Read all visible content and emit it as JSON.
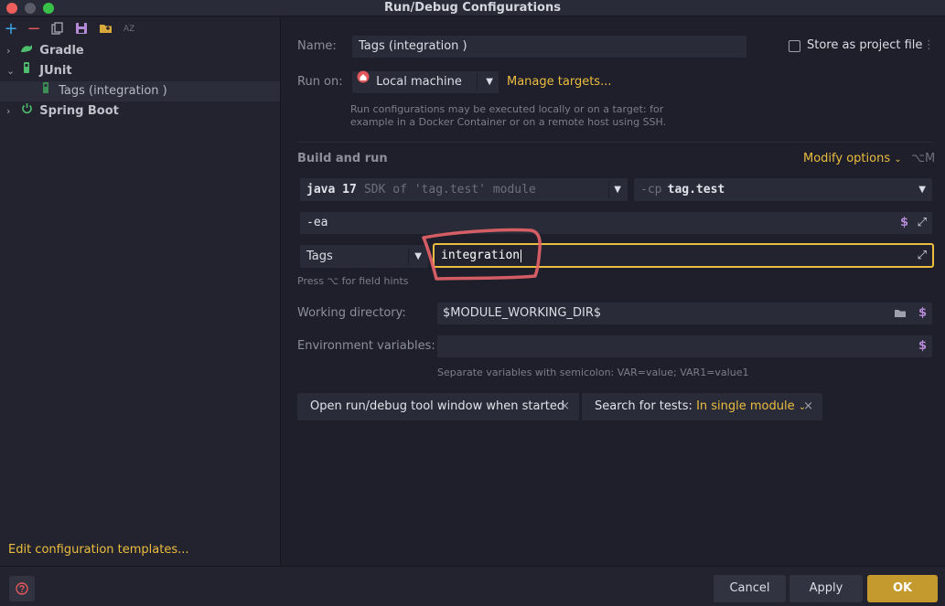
{
  "window": {
    "title": "Run/Debug Configurations"
  },
  "toolbar": {
    "add_icon": "+",
    "remove_icon": "−",
    "copy_icon": "copy-icon",
    "save_icon": "save-icon",
    "folder_icon": "new-folder-icon",
    "sort_label": "AZ"
  },
  "tree": {
    "items": [
      {
        "label": "Gradle"
      },
      {
        "label": "JUnit"
      },
      {
        "label": "Tags (integration )"
      },
      {
        "label": "Spring Boot"
      }
    ]
  },
  "sidebar": {
    "edit_templates": "Edit configuration templates..."
  },
  "form": {
    "name_label": "Name:",
    "name_value": "Tags (integration )",
    "store_label": "Store as project file",
    "run_on_label": "Run on:",
    "run_on_value": "Local machine",
    "manage_targets": "Manage targets...",
    "run_on_hint_1": "Run configurations may be executed locally or on a target: for",
    "run_on_hint_2": "example in a Docker Container or on a remote host using SSH.",
    "build_run_label": "Build and run",
    "modify_options": "Modify options",
    "modify_shortcut": "⌥M",
    "jdk_main": "java 17",
    "jdk_sub": "SDK of 'tag.test' module",
    "cp_prefix": "-cp",
    "cp_value": "tag.test",
    "vm_options": "-ea",
    "test_kind": "Tags",
    "tags_value": "integration",
    "field_hint": "Press ⌥ for field hints",
    "workdir_label": "Working directory:",
    "workdir_value": "$MODULE_WORKING_DIR$",
    "env_label": "Environment variables:",
    "env_value": "",
    "env_hint": "Separate variables with semicolon: VAR=value; VAR1=value1",
    "chip1": "Open run/debug tool window when started",
    "chip2_label": "Search for tests:",
    "chip2_value": "In single module"
  },
  "buttons": {
    "cancel": "Cancel",
    "apply": "Apply",
    "ok": "OK"
  },
  "colors": {
    "accent": "#ecbd3f",
    "annotation": "#e8646a",
    "ok_bg": "#c49a2e"
  }
}
